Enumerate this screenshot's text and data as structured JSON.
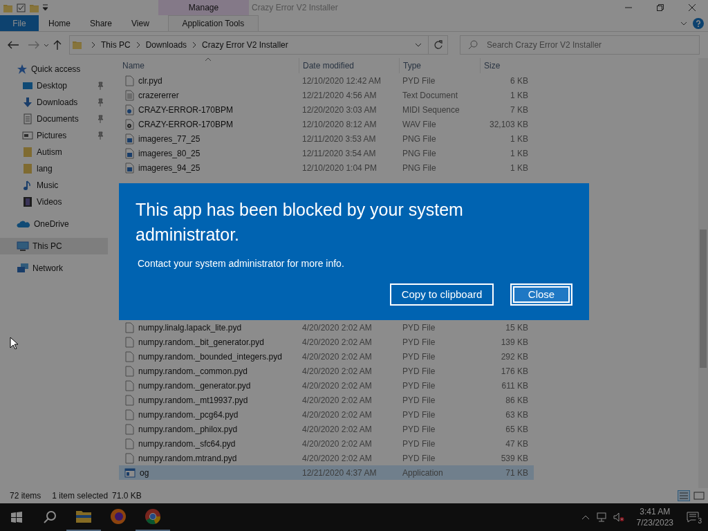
{
  "window": {
    "title": "Crazy Error V2 Installer"
  },
  "ribbon": {
    "context_group": "Manage",
    "tabs": [
      {
        "label": "File",
        "kind": "file"
      },
      {
        "label": "Home",
        "kind": "normal"
      },
      {
        "label": "Share",
        "kind": "normal"
      },
      {
        "label": "View",
        "kind": "normal"
      },
      {
        "label": "Application Tools",
        "kind": "contextual"
      }
    ]
  },
  "address": {
    "path": [
      "This PC",
      "Downloads",
      "Crazy Error V2 Installer"
    ]
  },
  "search": {
    "placeholder": "Search Crazy Error V2 Installer"
  },
  "sidebar": {
    "items": [
      {
        "label": "Quick access",
        "kind": "star",
        "selected": false,
        "children": [
          {
            "label": "Desktop",
            "kind": "desktop",
            "pinned": true,
            "selected": false
          },
          {
            "label": "Downloads",
            "kind": "download",
            "pinned": true,
            "selected": false
          },
          {
            "label": "Documents",
            "kind": "document",
            "pinned": true,
            "selected": false
          },
          {
            "label": "Pictures",
            "kind": "pictures",
            "pinned": true,
            "selected": false
          },
          {
            "label": "Autism",
            "kind": "folder",
            "pinned": false,
            "selected": false
          },
          {
            "label": "lang",
            "kind": "folder",
            "pinned": false,
            "selected": false
          },
          {
            "label": "Music",
            "kind": "music",
            "pinned": false,
            "selected": false
          },
          {
            "label": "Videos",
            "kind": "video",
            "pinned": false,
            "selected": false
          }
        ]
      },
      {
        "label": "OneDrive",
        "kind": "cloud",
        "selected": false
      },
      {
        "label": "This PC",
        "kind": "pc",
        "selected": true
      },
      {
        "label": "Network",
        "kind": "network",
        "selected": false
      }
    ]
  },
  "file_list": {
    "columns": [
      "Name",
      "Date modified",
      "Type",
      "Size"
    ],
    "rows_top": [
      {
        "name": "clr.pyd",
        "date": "12/10/2020 12:42 AM",
        "type": "PYD File",
        "size": "6 KB",
        "kind": "blank",
        "selected": false
      },
      {
        "name": "crazererrer",
        "date": "12/21/2020 4:56 AM",
        "type": "Text Document",
        "size": "1 KB",
        "kind": "text",
        "selected": false
      },
      {
        "name": "CRAZY-ERROR-170BPM",
        "date": "12/20/2020 3:03 AM",
        "type": "MIDI Sequence",
        "size": "7 KB",
        "kind": "midi",
        "selected": false
      },
      {
        "name": "CRAZY-ERROR-170BPM",
        "date": "12/10/2020 8:12 AM",
        "type": "WAV File",
        "size": "32,103 KB",
        "kind": "audio",
        "selected": false
      },
      {
        "name": "imageres_77_25",
        "date": "12/11/2020 3:53 AM",
        "type": "PNG File",
        "size": "1 KB",
        "kind": "image",
        "selected": false
      },
      {
        "name": "imageres_80_25",
        "date": "12/11/2020 3:54 AM",
        "type": "PNG File",
        "size": "1 KB",
        "kind": "image",
        "selected": false
      },
      {
        "name": "imageres_94_25",
        "date": "12/10/2020 1:04 PM",
        "type": "PNG File",
        "size": "1 KB",
        "kind": "image",
        "selected": false
      }
    ],
    "rows_bottom": [
      {
        "name": "numpy.linalg.lapack_lite.pyd",
        "date": "4/20/2020 2:02 AM",
        "type": "PYD File",
        "size": "15 KB",
        "kind": "blank",
        "selected": false
      },
      {
        "name": "numpy.random._bit_generator.pyd",
        "date": "4/20/2020 2:02 AM",
        "type": "PYD File",
        "size": "139 KB",
        "kind": "blank",
        "selected": false
      },
      {
        "name": "numpy.random._bounded_integers.pyd",
        "date": "4/20/2020 2:02 AM",
        "type": "PYD File",
        "size": "292 KB",
        "kind": "blank",
        "selected": false
      },
      {
        "name": "numpy.random._common.pyd",
        "date": "4/20/2020 2:02 AM",
        "type": "PYD File",
        "size": "176 KB",
        "kind": "blank",
        "selected": false
      },
      {
        "name": "numpy.random._generator.pyd",
        "date": "4/20/2020 2:02 AM",
        "type": "PYD File",
        "size": "611 KB",
        "kind": "blank",
        "selected": false
      },
      {
        "name": "numpy.random._mt19937.pyd",
        "date": "4/20/2020 2:02 AM",
        "type": "PYD File",
        "size": "86 KB",
        "kind": "blank",
        "selected": false
      },
      {
        "name": "numpy.random._pcg64.pyd",
        "date": "4/20/2020 2:02 AM",
        "type": "PYD File",
        "size": "63 KB",
        "kind": "blank",
        "selected": false
      },
      {
        "name": "numpy.random._philox.pyd",
        "date": "4/20/2020 2:02 AM",
        "type": "PYD File",
        "size": "65 KB",
        "kind": "blank",
        "selected": false
      },
      {
        "name": "numpy.random._sfc64.pyd",
        "date": "4/20/2020 2:02 AM",
        "type": "PYD File",
        "size": "47 KB",
        "kind": "blank",
        "selected": false
      },
      {
        "name": "numpy.random.mtrand.pyd",
        "date": "4/20/2020 2:02 AM",
        "type": "PYD File",
        "size": "539 KB",
        "kind": "blank",
        "selected": false
      },
      {
        "name": "og",
        "date": "12/21/2020 4:37 AM",
        "type": "Application",
        "size": "71 KB",
        "kind": "app",
        "selected": true
      }
    ]
  },
  "status_bar": {
    "item_count": "72 items",
    "selection": "1 item selected",
    "selection_size": "71.0 KB"
  },
  "dialog": {
    "title": "This app has been blocked by your system administrator.",
    "message": "Contact your system administrator for more info.",
    "buttons": [
      {
        "label": "Copy to clipboard",
        "focused": false
      },
      {
        "label": "Close",
        "focused": true
      }
    ]
  },
  "taskbar": {
    "apps": [
      {
        "kind": "explorer",
        "running": true
      },
      {
        "kind": "firefox",
        "running": false
      },
      {
        "kind": "chrome",
        "running": true
      }
    ],
    "time": "3:41 AM",
    "date": "7/23/2023",
    "notifications": "3"
  }
}
